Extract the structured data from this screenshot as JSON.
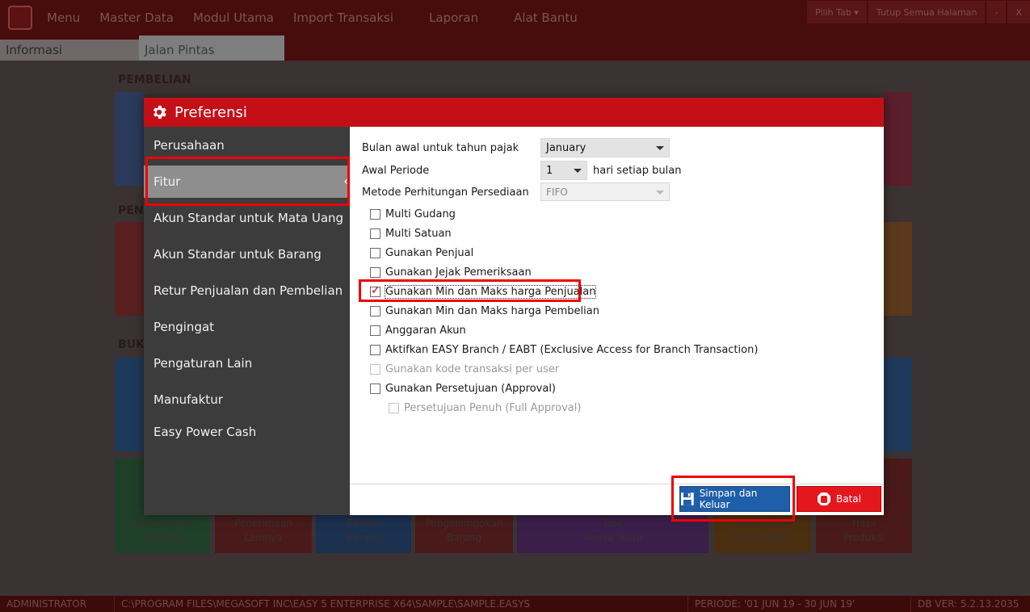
{
  "app": {
    "menu": [
      "Menu",
      "Master Data",
      "Modul Utama",
      "Import Transaksi",
      "Laporan",
      "Alat Bantu"
    ],
    "right_controls": [
      "Pilih Tab ▾",
      "Tutup Semua Halaman",
      "-",
      "X"
    ],
    "tabs": [
      "Informasi",
      "Jalan Pintas"
    ],
    "sections": [
      "PEMBELIAN",
      "PEN",
      "BUK"
    ],
    "bottom_tiles": [
      "Pembayaran\nLainnya",
      "Penerimaan\nLainnya",
      "Pindah\nBarang",
      "Pengelompokan\nBarang",
      "Tipe\nAktiva Tetap",
      "Pengeluaran\nBahan Baku",
      "Hasil\nProduksi"
    ],
    "status": {
      "user": "ADMINISTRATOR",
      "path": "C:\\PROGRAM FILES\\MEGASOFT INC\\EASY 5 ENTERPRISE X64\\SAMPLE\\SAMPLE.EASYS",
      "period": "PERIODE: '01 JUN 19 - 30 JUN 19'",
      "version": "DB VER: 5.2.13.2035"
    }
  },
  "dialog": {
    "title": "Preferensi",
    "sidebar": [
      {
        "label": "Perusahaan"
      },
      {
        "label": "Fitur"
      },
      {
        "label": "Akun Standar untuk Mata Uang"
      },
      {
        "label": "Akun Standar untuk Barang"
      },
      {
        "label": "Retur Penjualan dan Pembelian"
      },
      {
        "label": "Pengingat"
      },
      {
        "label": "Pengaturan Lain"
      },
      {
        "label": "Manufaktur"
      },
      {
        "label": "Easy Power Cash"
      }
    ],
    "fields": {
      "tax_month_label": "Bulan awal untuk tahun pajak",
      "tax_month_value": "January",
      "period_label": "Awal Periode",
      "period_value": "1",
      "period_suffix": "hari setiap bulan",
      "inventory_label": "Metode Perhitungan Persediaan",
      "inventory_value": "FIFO"
    },
    "checkboxes": [
      {
        "label": "Multi Gudang",
        "checked": false,
        "disabled": false
      },
      {
        "label": "Multi Satuan",
        "checked": false,
        "disabled": false
      },
      {
        "label": "Gunakan Penjual",
        "checked": false,
        "disabled": false
      },
      {
        "label": "Gunakan Jejak Pemeriksaan",
        "checked": false,
        "disabled": false
      },
      {
        "label": "Gunakan Min dan Maks harga Penjualan",
        "checked": true,
        "disabled": false
      },
      {
        "label": "Gunakan Min dan Maks harga Pembelian",
        "checked": false,
        "disabled": false
      },
      {
        "label": "Anggaran Akun",
        "checked": false,
        "disabled": false
      },
      {
        "label": "Aktifkan EASY Branch / EABT (Exclusive Access for Branch Transaction)",
        "checked": false,
        "disabled": false
      },
      {
        "label": "Gunakan kode transaksi per user",
        "checked": false,
        "disabled": true
      },
      {
        "label": "Gunakan Persetujuan (Approval)",
        "checked": false,
        "disabled": false
      },
      {
        "label": "Persetujuan Penuh (Full Approval)",
        "checked": false,
        "disabled": true
      }
    ],
    "buttons": {
      "save": "Simpan dan Keluar",
      "cancel": "Batal"
    }
  }
}
